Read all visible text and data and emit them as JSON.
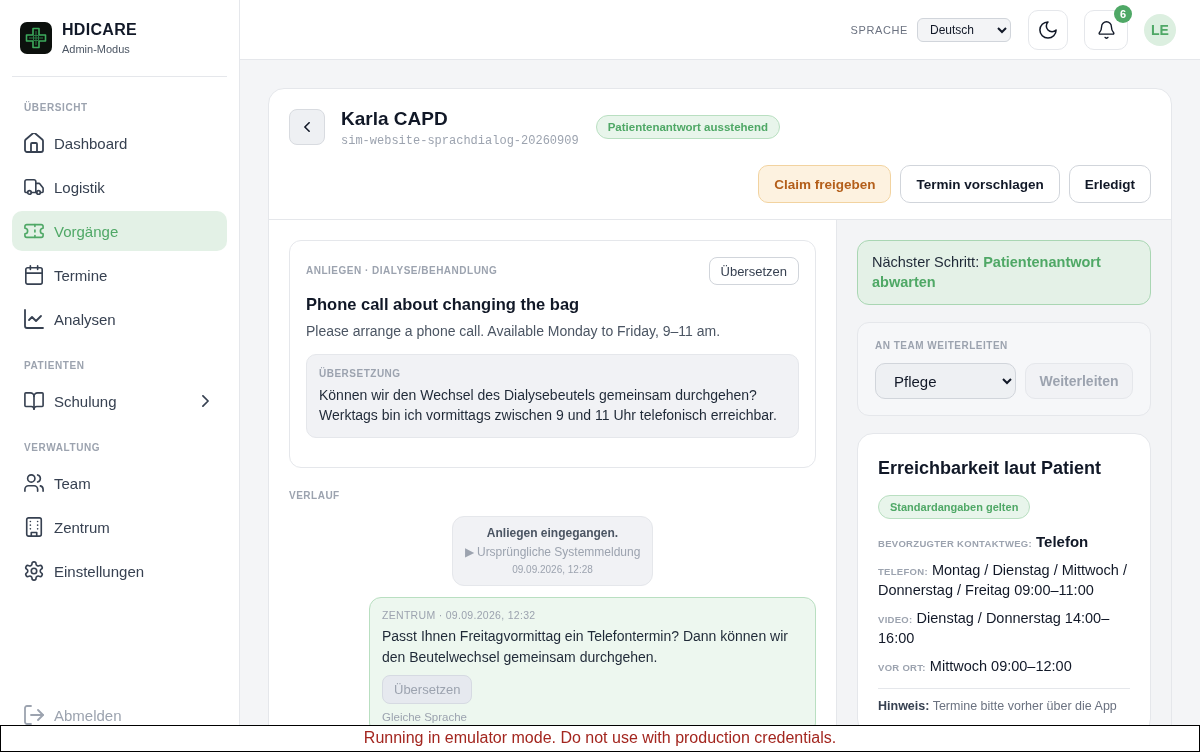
{
  "sidebar": {
    "brand": {
      "name": "HDICARE",
      "subtitle": "Admin-Modus"
    },
    "sections": [
      {
        "title": "ÜBERSICHT",
        "items": [
          {
            "label": "Dashboard",
            "selected": false
          },
          {
            "label": "Logistik",
            "selected": false
          },
          {
            "label": "Vorgänge",
            "selected": true
          },
          {
            "label": "Termine",
            "selected": false
          },
          {
            "label": "Analysen",
            "selected": false
          }
        ]
      },
      {
        "title": "PATIENTEN",
        "items": [
          {
            "label": "Schulung",
            "selected": false,
            "expanded": false
          }
        ]
      },
      {
        "title": "VERWALTUNG",
        "items": [
          {
            "label": "Team",
            "selected": false
          },
          {
            "label": "Zentrum",
            "selected": false
          },
          {
            "label": "Einstellungen",
            "selected": false
          }
        ]
      }
    ],
    "logout": "Abmelden"
  },
  "header": {
    "language_label": "SPRACHE",
    "language": "Deutsch",
    "notification_count": "6",
    "avatar_initials": "LE"
  },
  "case": {
    "title": "Karla CAPD",
    "id": "sim-website-sprachdialog-20260909",
    "status": "Patientenantwort ausstehend",
    "actions": [
      {
        "label": "Claim freigeben",
        "kind": "warning"
      },
      {
        "label": "Termin vorschlagen",
        "kind": "outline"
      },
      {
        "label": "Erledigt",
        "kind": "outline"
      }
    ]
  },
  "request": {
    "category": "ANLIEGEN · DIALYSE/BEHANDLUNG",
    "translate_button": "Übersetzen",
    "title": "Phone call about changing the bag",
    "text": "Please arrange a phone call. Available Monday to Friday, 9–11 am.",
    "translation": {
      "label": "ÜBERSETZUNG",
      "text": "Können wir den Wechsel des Dialysebeutels gemeinsam durchgehen? Werktags bin ich vormittags zwischen 9 und 11 Uhr telefonisch erreichbar."
    }
  },
  "history": {
    "label": "VERLAUF",
    "entries": [
      {
        "kind": "system",
        "title": "Anliegen eingegangen.",
        "toggle": "▶ Ursprüngliche Systemmeldung",
        "time": "09.09.2026, 12:28"
      },
      {
        "kind": "message",
        "meta": "ZENTRUM · 09.09.2026, 12:32",
        "text": "Passt Ihnen Freitagvormittag ein Telefontermin? Dann können wir den Beutelwechsel gemeinsam durchgehen.",
        "translate_button": {
          "label": "Übersetzen",
          "disabled": true
        },
        "note": "Gleiche Sprache"
      }
    ]
  },
  "next_step": "Nächster Schritt: **Patientenantwort abwarten**",
  "forward": {
    "label": "AN TEAM WEITERLEITEN",
    "team": "Pflege",
    "button": {
      "label": "Weiterleiten",
      "disabled": true
    }
  },
  "availability": {
    "title": "Erreichbarkeit laut Patient",
    "badge": "Standardangaben gelten",
    "preferred": {
      "label": "BEVORZUGTER KONTAKTWEG:",
      "value": "Telefon"
    },
    "times": [
      {
        "label": "TELEFON:",
        "value": "Montag / Dienstag / Mittwoch / Donnerstag / Freitag 09:00–11:00"
      },
      {
        "label": "VIDEO:",
        "value": "Dienstag / Donnerstag 14:00–16:00"
      },
      {
        "label": "VOR ORT:",
        "value": "Mittwoch 09:00–12:00"
      }
    ],
    "note": "**Hinweis:** Termine bitte vorher über die App"
  },
  "banner": "Running in emulator mode. Do not use with production credentials."
}
